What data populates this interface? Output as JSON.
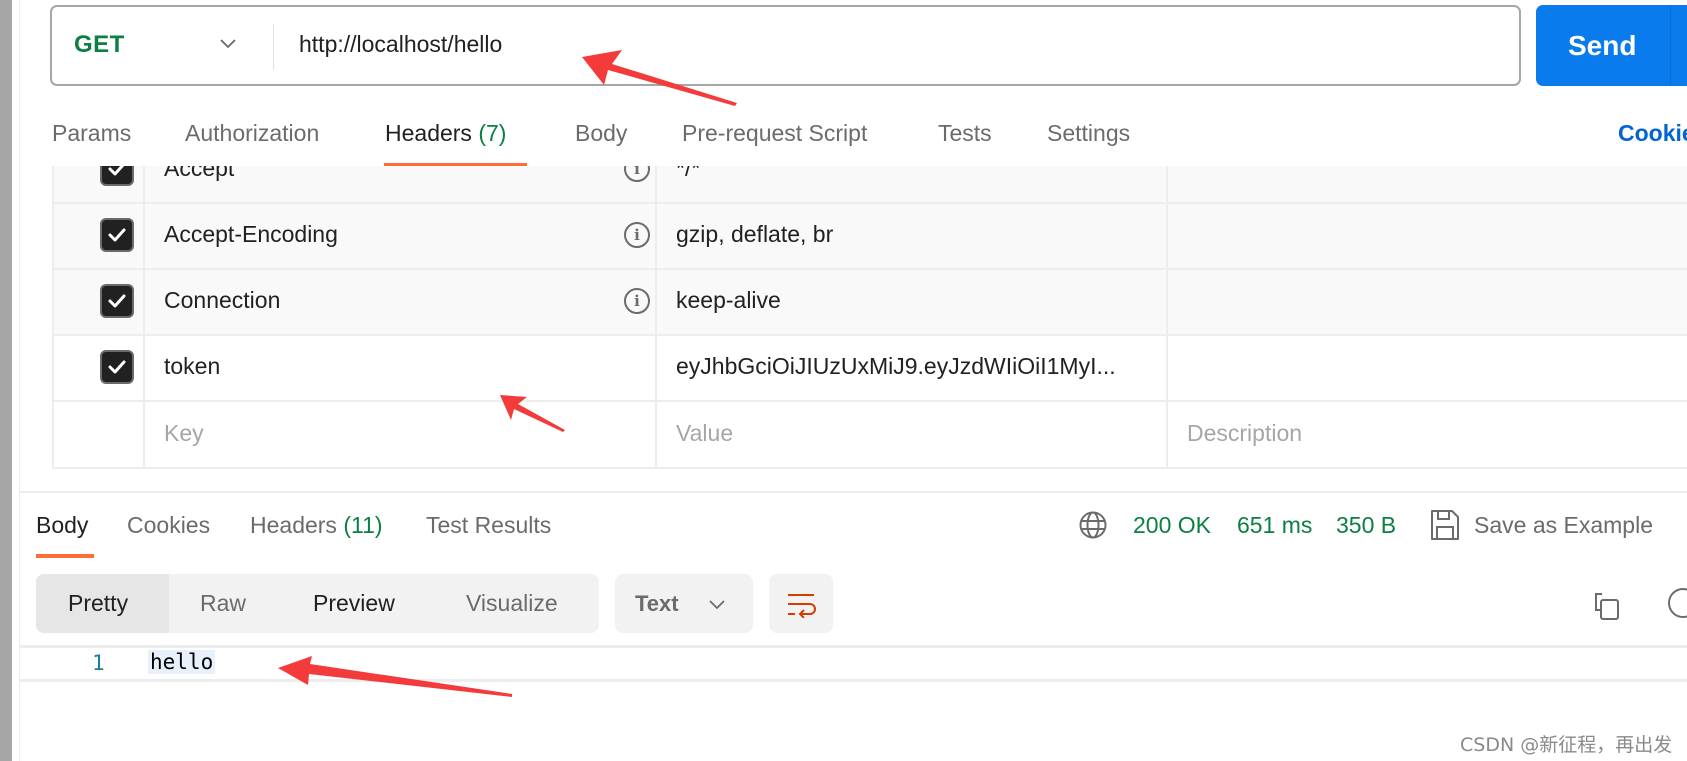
{
  "request": {
    "method": "GET",
    "url": "http://localhost/hello",
    "send_label": "Send",
    "tabs": [
      {
        "label": "Params",
        "count": null
      },
      {
        "label": "Authorization",
        "count": null
      },
      {
        "label": "Headers",
        "count": "(7)",
        "active": true
      },
      {
        "label": "Body",
        "count": null
      },
      {
        "label": "Pre-request Script",
        "count": null
      },
      {
        "label": "Tests",
        "count": null
      },
      {
        "label": "Settings",
        "count": null
      }
    ],
    "cookies_link": "Cookies"
  },
  "headers_table": {
    "rows": [
      {
        "checked": true,
        "key": "Accept",
        "value": "*/*",
        "info": true
      },
      {
        "checked": true,
        "key": "Accept-Encoding",
        "value": "gzip, deflate, br",
        "info": true
      },
      {
        "checked": true,
        "key": "Connection",
        "value": "keep-alive",
        "info": true
      },
      {
        "checked": true,
        "key": "token",
        "value": "eyJhbGciOiJIUzUxMiJ9.eyJzdWIiOiI1MyI...",
        "info": false
      }
    ],
    "new_row": {
      "key_placeholder": "Key",
      "value_placeholder": "Value",
      "description_placeholder": "Description"
    }
  },
  "response": {
    "tabs": [
      {
        "label": "Body",
        "count": null,
        "active": true
      },
      {
        "label": "Cookies",
        "count": null
      },
      {
        "label": "Headers",
        "count": "(11)"
      },
      {
        "label": "Test Results",
        "count": null
      }
    ],
    "status": "200 OK",
    "time": "651 ms",
    "size": "350 B",
    "save_example": "Save as Example",
    "view_modes": [
      "Pretty",
      "Raw",
      "Preview",
      "Visualize"
    ],
    "active_view_mode": "Pretty",
    "format": "Text",
    "body_lines": [
      {
        "line": "1",
        "text": "hello"
      }
    ]
  },
  "icons": {
    "method_dropdown": "chevron-down-icon",
    "info": "info-icon",
    "checkbox": "checkbox-checked-icon",
    "globe": "globe-icon",
    "save": "save-icon",
    "format_dropdown": "chevron-down-icon",
    "wrap": "wrap-lines-icon",
    "copy": "copy-icon",
    "search": "search-icon"
  },
  "colors": {
    "accent_orange": "#ff6c37",
    "send_blue": "#097bed",
    "success_green": "#0b8043",
    "link_blue": "#0265d2",
    "annotation_red": "#f33b3b"
  },
  "watermark": "CSDN @新征程，再出发"
}
